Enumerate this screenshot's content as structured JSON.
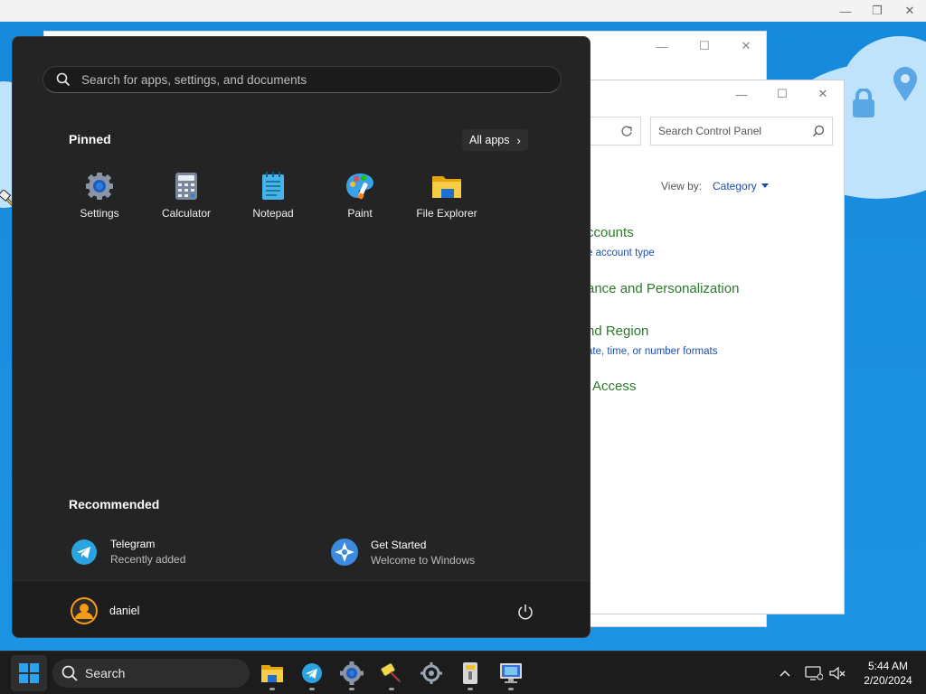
{
  "start_menu": {
    "search_placeholder": "Search for apps, settings, and documents",
    "pinned_title": "Pinned",
    "all_apps_label": "All apps",
    "pinned_apps": [
      {
        "label": "Settings",
        "icon": "settings-icon"
      },
      {
        "label": "Calculator",
        "icon": "calculator-icon"
      },
      {
        "label": "Notepad",
        "icon": "notepad-icon"
      },
      {
        "label": "Paint",
        "icon": "paint-icon"
      },
      {
        "label": "File Explorer",
        "icon": "file-explorer-icon"
      }
    ],
    "recommended_title": "Recommended",
    "recommended": [
      {
        "title": "Telegram",
        "subtitle": "Recently added",
        "icon": "telegram-icon"
      },
      {
        "title": "Get Started",
        "subtitle": "Welcome to Windows",
        "icon": "get-started-icon"
      }
    ],
    "user_name": "daniel"
  },
  "control_panel": {
    "search_placeholder": "Search Control Panel",
    "view_by_label": "View by:",
    "view_by_value": "Category",
    "items": [
      {
        "heading": "ccounts",
        "link": "e account type"
      },
      {
        "heading": "ance and Personalization",
        "link": ""
      },
      {
        "heading": "nd Region",
        "link": "ate, time, or number formats"
      },
      {
        "heading": "Access",
        "link": ""
      }
    ]
  },
  "taskbar": {
    "search_label": "Search",
    "apps": [
      "file-explorer-icon",
      "telegram-icon",
      "chrome-settings-icon",
      "paint-brush-icon",
      "settings-icon",
      "archive-icon",
      "monitor-icon"
    ],
    "time": "5:44 AM",
    "date": "2/20/2024"
  },
  "colors": {
    "accent": "#0067c0",
    "desktop": "#1689db",
    "start_bg": "#242424",
    "taskbar_bg": "#1c1c1c",
    "cp_heading": "#2a7a2a",
    "cp_link": "#1e4fb0"
  }
}
